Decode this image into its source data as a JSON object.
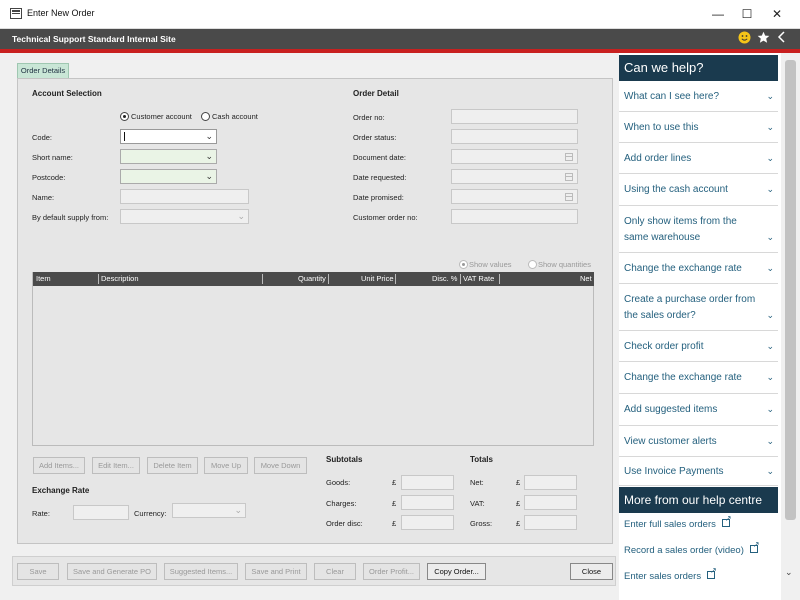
{
  "window": {
    "title": "Enter New Order",
    "controls": {
      "minimize": "—",
      "maximize": "☐",
      "close": "✕"
    }
  },
  "site": {
    "title": "Technical Support Standard Internal Site",
    "icons": [
      "smiley-icon",
      "star-icon",
      "chevron-left-icon"
    ]
  },
  "tabs": [
    {
      "label": "Order Details",
      "active": true
    }
  ],
  "account_selection": {
    "heading": "Account Selection",
    "radio_customer": "Customer account",
    "radio_cash": "Cash account",
    "selected": "customer",
    "code_label": "Code:",
    "short_name_label": "Short name:",
    "postcode_label": "Postcode:",
    "name_label": "Name:",
    "supply_label": "By default supply from:"
  },
  "order_detail": {
    "heading": "Order Detail",
    "order_no_label": "Order no:",
    "order_status_label": "Order status:",
    "document_date_label": "Document date:",
    "date_requested_label": "Date requested:",
    "date_promised_label": "Date promised:",
    "customer_order_no_label": "Customer order no:"
  },
  "view_options": {
    "show_values": "Show values",
    "show_quantities": "Show quantities",
    "selected": "values"
  },
  "grid": {
    "columns": [
      "Item",
      "Description",
      "Quantity",
      "Unit Price",
      "Disc. %",
      "VAT Rate",
      "Net"
    ],
    "rows": []
  },
  "line_buttons": [
    "Add Items...",
    "Edit Item...",
    "Delete Item",
    "Move Up",
    "Move Down"
  ],
  "exchange_rate": {
    "heading": "Exchange Rate",
    "rate_label": "Rate:",
    "currency_label": "Currency:"
  },
  "subtotals": {
    "heading": "Subtotals",
    "goods_label": "Goods:",
    "charges_label": "Charges:",
    "order_disc_label": "Order disc:",
    "currency_symbol": "£"
  },
  "totals": {
    "heading": "Totals",
    "net_label": "Net:",
    "vat_label": "VAT:",
    "gross_label": "Gross:",
    "currency_symbol": "£"
  },
  "footer_buttons": {
    "save": "Save",
    "save_generate_po": "Save and Generate PO",
    "suggested_items": "Suggested Items...",
    "save_print": "Save and Print",
    "clear": "Clear",
    "order_profit": "Order Profit...",
    "copy_order": "Copy Order...",
    "close": "Close"
  },
  "help": {
    "heading": "Can we help?",
    "items": [
      "What can I see here?",
      "When to use this",
      "Add order lines",
      "Using the cash account",
      "Only show items from the same warehouse",
      "Change the exchange rate",
      "Create a purchase order from the sales order?",
      "Check order profit",
      "Change the exchange rate",
      "Add suggested items",
      "View customer alerts",
      "Use Invoice Payments"
    ],
    "more_heading": "More from our help centre",
    "more_links": [
      "Enter full sales orders",
      "Record a sales order (video)",
      "Enter sales orders"
    ]
  },
  "colors": {
    "header_bg": "#4a4a4a",
    "accent_red": "#c8201f",
    "help_header_bg": "#1a3a4e",
    "help_link": "#24607e",
    "tab_bg": "#c9e6d6"
  }
}
